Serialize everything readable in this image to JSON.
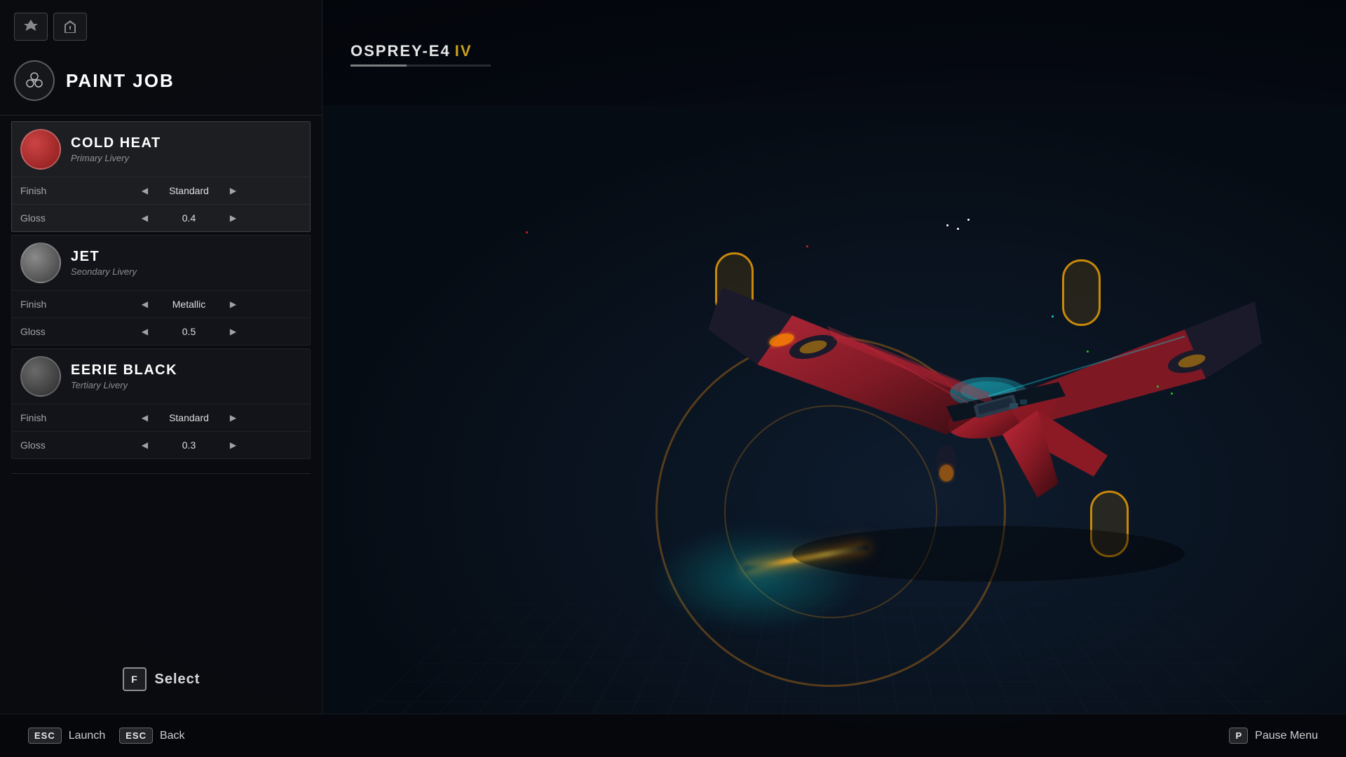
{
  "header": {
    "ship_name": "OSPREY-E4",
    "ship_tier": "IV",
    "section_title": "PAINT JOB"
  },
  "liveries": [
    {
      "id": "cold-heat",
      "name": "COLD HEAT",
      "sub": "Primary Livery",
      "color_type": "cold-heat",
      "selected": true,
      "finish_label": "Finish",
      "finish_value": "Standard",
      "gloss_label": "Gloss",
      "gloss_value": "0.4"
    },
    {
      "id": "jet",
      "name": "JET",
      "sub": "Seondary Livery",
      "color_type": "jet",
      "selected": false,
      "finish_label": "Finish",
      "finish_value": "Metallic",
      "gloss_label": "Gloss",
      "gloss_value": "0.5"
    },
    {
      "id": "eerie-black",
      "name": "EERIE BLACK",
      "sub": "Tertiary Livery",
      "color_type": "eerie-black",
      "selected": false,
      "finish_label": "Finish",
      "finish_value": "Standard",
      "gloss_label": "Gloss",
      "gloss_value": "0.3"
    }
  ],
  "actions": {
    "select_key": "F",
    "select_label": "Select",
    "launch_key": "ESC",
    "launch_label": "Launch",
    "back_key": "ESC",
    "back_label": "Back",
    "pause_key": "P",
    "pause_label": "Pause Menu"
  },
  "icons": {
    "triquetra": "⚇",
    "nav_1": "nav1",
    "nav_2": "nav2"
  }
}
